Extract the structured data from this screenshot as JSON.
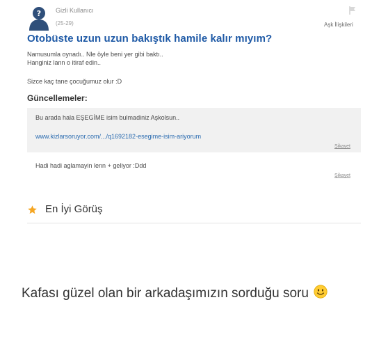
{
  "user": {
    "name": "Gizli Kullanıcı",
    "age_range": "(25-29)"
  },
  "category": "Aşk İlişkileri",
  "question": {
    "title": "Otobüste uzun uzun bakıştık hamile kalır mıyım?",
    "body_lines": [
      "Namusumla oynadı.. Nle öyle beni yer gibi baktı..",
      "Hanginiz lann o itiraf edin..",
      "Sizce kaç tane çocuğumuz olur :D"
    ]
  },
  "updates": {
    "heading": "Güncellemeler:",
    "items": [
      {
        "text": "Bu arada hala EŞEGİME isim bulmadiniz Aşkolsun..",
        "link": "www.kizlarsoruyor.com/.../q1692182-esegime-isim-ariyorum",
        "report": "Şikayet"
      },
      {
        "text": "Hadi hadi aglamayin lenn + geliyor :Ddd",
        "report": "Şikayet"
      }
    ]
  },
  "best_answer": {
    "label": "En İyi Görüş"
  },
  "caption": {
    "text": "Kafası güzel olan bir arkadaşımızın sorduğu soru"
  },
  "colors": {
    "title_blue": "#1f5aa6",
    "link_blue": "#2a6bb0",
    "star_orange": "#f5a623",
    "update_bg": "#f1f1f1"
  },
  "icons": [
    "anonymous-avatar-icon",
    "flag-icon",
    "star-icon",
    "slightly-smiling-face-emoji"
  ]
}
